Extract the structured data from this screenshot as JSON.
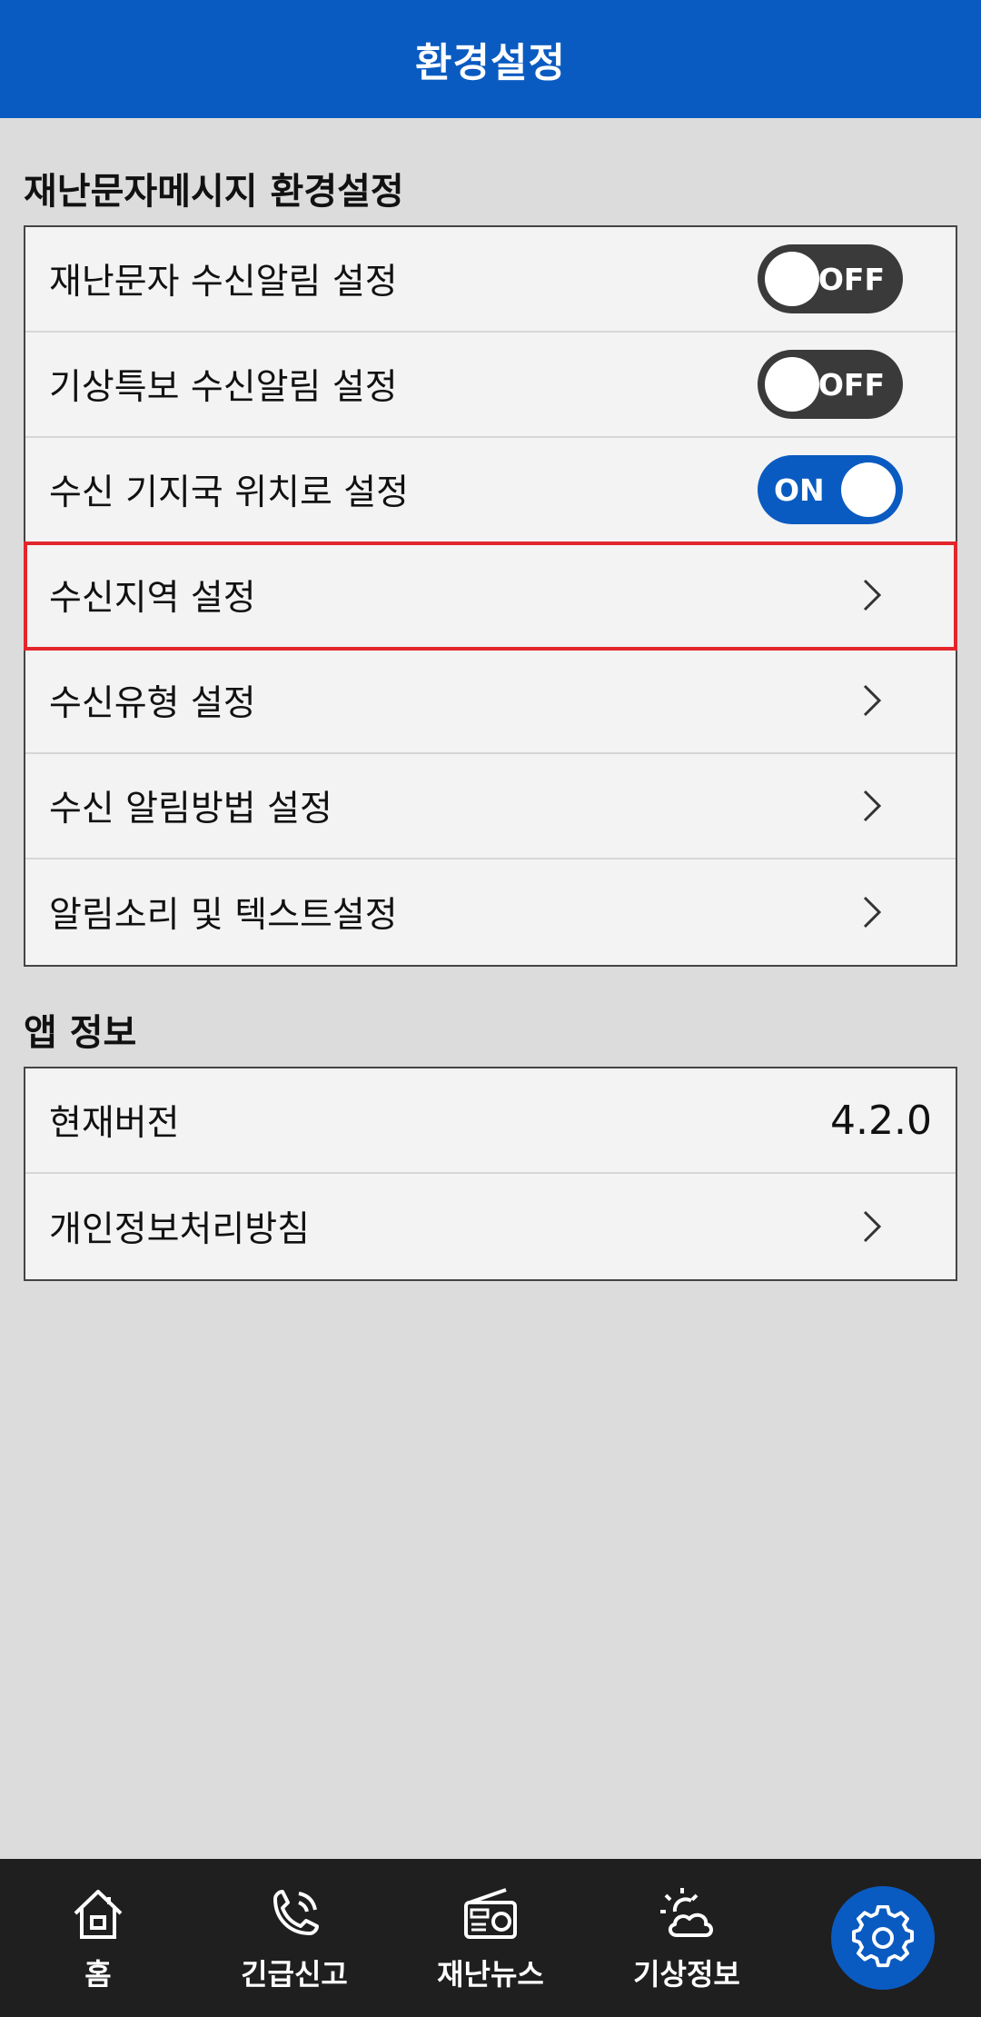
{
  "header": {
    "title": "환경설정"
  },
  "alerts_section": {
    "title": "재난문자메시지 환경설정",
    "toggles": [
      {
        "label": "재난문자 수신알림 설정",
        "state": "OFF"
      },
      {
        "label": "기상특보 수신알림 설정",
        "state": "OFF"
      },
      {
        "label": "수신 기지국 위치로 설정",
        "state": "ON"
      }
    ],
    "links": [
      {
        "label": "수신지역 설정"
      },
      {
        "label": "수신유형 설정"
      },
      {
        "label": "수신 알림방법 설정"
      },
      {
        "label": "알림소리 및 텍스트설정"
      }
    ]
  },
  "app_info": {
    "title": "앱 정보",
    "version_label": "현재버전",
    "version_value": "4.2.0",
    "privacy_label": "개인정보처리방침"
  },
  "bottom_nav": {
    "items": [
      {
        "label": "홈",
        "icon": "home-icon"
      },
      {
        "label": "긴급신고",
        "icon": "phone-icon"
      },
      {
        "label": "재난뉴스",
        "icon": "radio-icon"
      },
      {
        "label": "기상정보",
        "icon": "weather-icon"
      },
      {
        "label": "",
        "icon": "gear-icon"
      }
    ]
  },
  "colors": {
    "brand": "#0a5bc1",
    "highlight": "#e3262b"
  }
}
